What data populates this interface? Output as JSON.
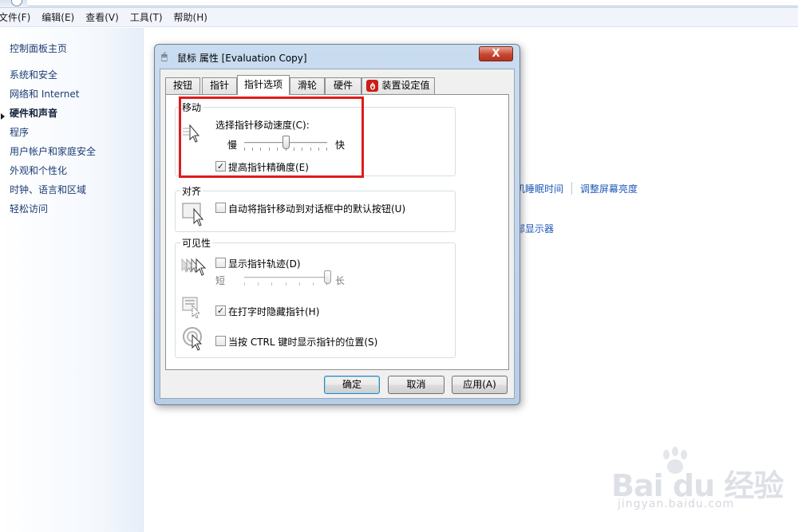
{
  "menubar": {
    "items": [
      "文件(F)",
      "编辑(E)",
      "查看(V)",
      "工具(T)",
      "帮助(H)"
    ]
  },
  "leftnav": {
    "home": "控制面板主页",
    "items": [
      "系统和安全",
      "网络和 Internet",
      "硬件和声音",
      "程序",
      "用户帐户和家庭安全",
      "外观和个性化",
      "时钟、语言和区域",
      "轻松访问"
    ],
    "active_index": 2
  },
  "background": {
    "link_sleep": "机睡眠时间",
    "link_brightness": "调整屏幕亮度",
    "link_display": "部显示器"
  },
  "dialog": {
    "title": "鼠标 属性 [Evaluation Copy]",
    "close_label": "X",
    "tabs": [
      "按钮",
      "指针",
      "指针选项",
      "滑轮",
      "硬件",
      "装置设定值"
    ],
    "active_tab": 2,
    "motion": {
      "title": "移动",
      "speed_label": "选择指针移动速度(C):",
      "slow": "慢",
      "fast": "快",
      "speed_value": 0.5,
      "precision_label": "提高指针精确度(E)",
      "precision_checked": true
    },
    "snap": {
      "title": "对齐",
      "label": "自动将指针移动到对话框中的默认按钮(U)",
      "checked": false
    },
    "visibility": {
      "title": "可见性",
      "trails_label": "显示指针轨迹(D)",
      "trails_checked": false,
      "short": "短",
      "long": "长",
      "trails_value": 1.0,
      "hide_label": "在打字时隐藏指针(H)",
      "hide_checked": true,
      "ctrl_label": "当按 CTRL 键时显示指针的位置(S)",
      "ctrl_checked": false
    },
    "buttons": {
      "ok": "确定",
      "cancel": "取消",
      "apply": "应用(A)"
    }
  },
  "colors": {
    "highlight": "#e01b1b",
    "link": "#1e5bb8"
  },
  "watermark": {
    "main": "Bai du 经验",
    "sub": "jingyan.baidu.com"
  }
}
